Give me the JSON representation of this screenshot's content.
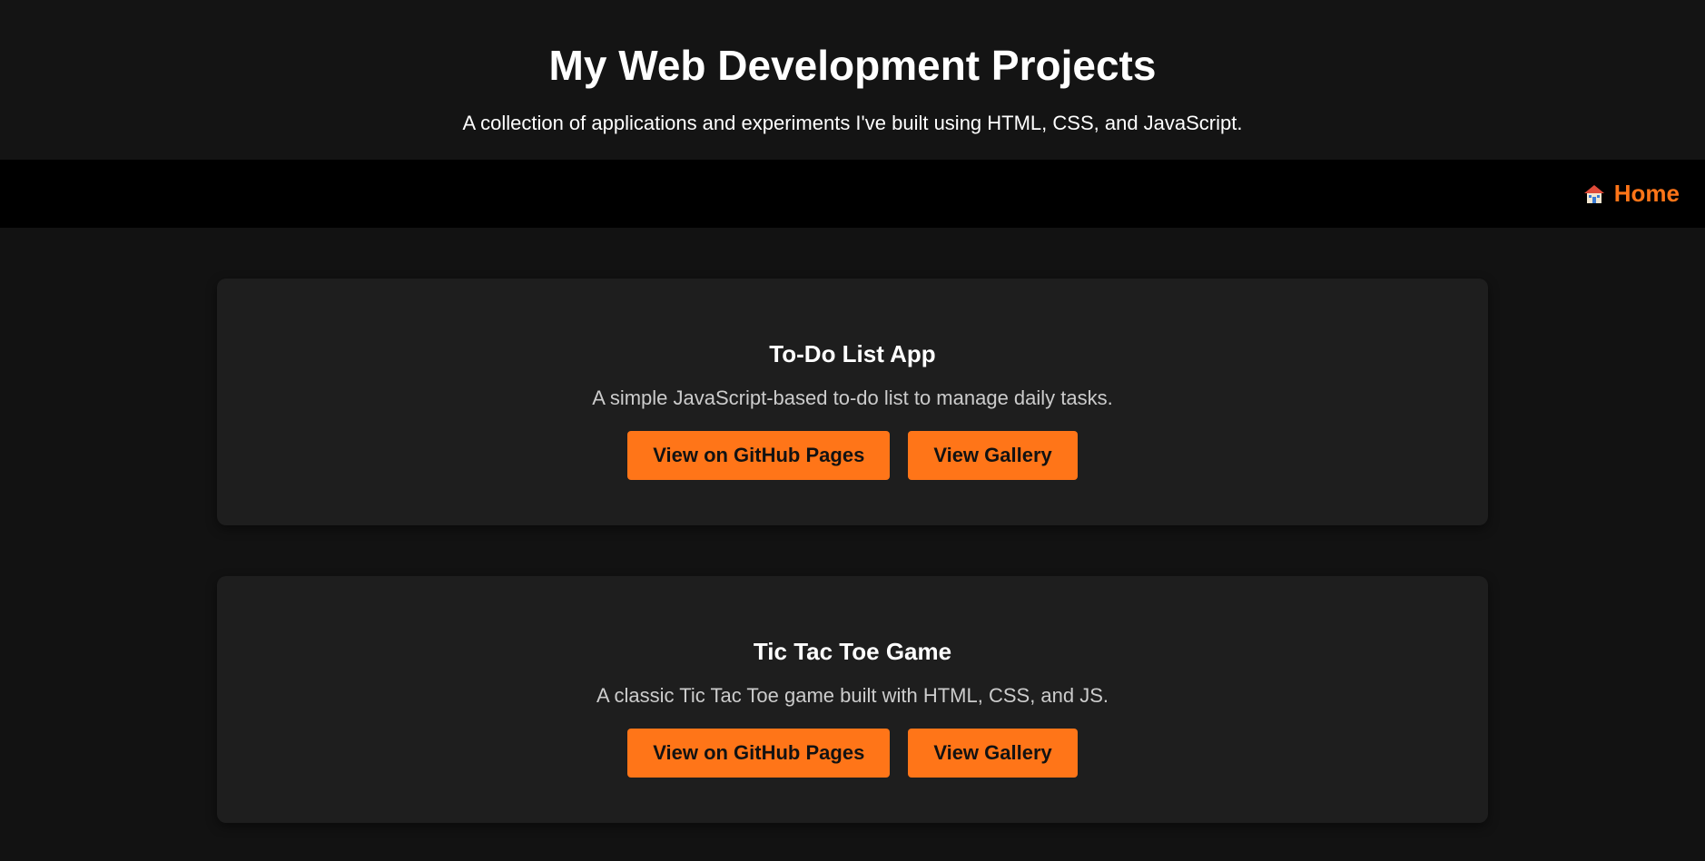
{
  "header": {
    "title": "My Web Development Projects",
    "subtitle": "A collection of applications and experiments I've built using HTML, CSS, and JavaScript."
  },
  "nav": {
    "home_label": "Home",
    "home_icon": "house-icon"
  },
  "colors": {
    "accent": "#ff7518",
    "card_bg": "#1e1e1e",
    "page_bg": "#121212",
    "nav_bg": "#000000"
  },
  "projects": [
    {
      "title": "To-Do List App",
      "description": "A simple JavaScript-based to-do list to manage daily tasks.",
      "primary_button": "View on GitHub Pages",
      "secondary_button": "View Gallery"
    },
    {
      "title": "Tic Tac Toe Game",
      "description": "A classic Tic Tac Toe game built with HTML, CSS, and JS.",
      "primary_button": "View on GitHub Pages",
      "secondary_button": "View Gallery"
    }
  ]
}
